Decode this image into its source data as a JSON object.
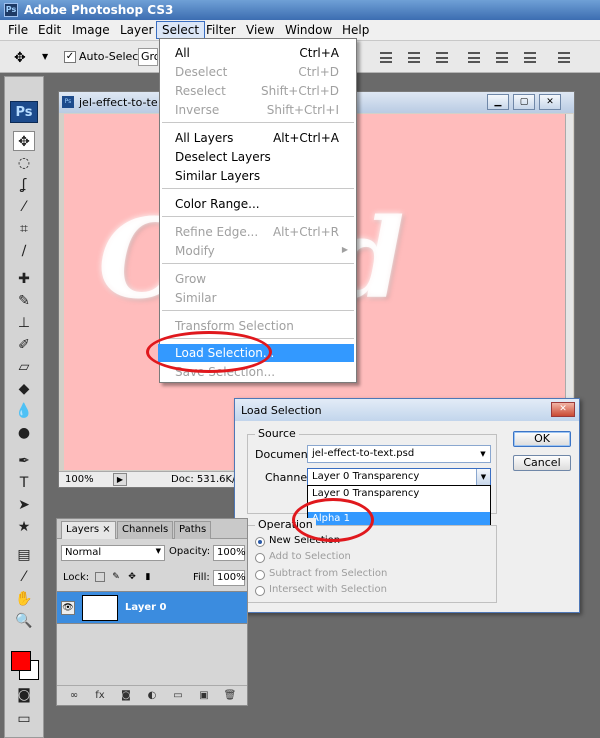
{
  "app": {
    "title": "Adobe Photoshop CS3",
    "logo": "Ps"
  },
  "menubar": {
    "items": [
      "File",
      "Edit",
      "Image",
      "Layer",
      "Select",
      "Filter",
      "View",
      "Window",
      "Help"
    ],
    "active": "Select"
  },
  "options_bar": {
    "auto_select_label": "Auto-Select:",
    "auto_select_checked": true,
    "auto_select_value": "Gro"
  },
  "document": {
    "title": "jel-effect-to-te",
    "zoom": "100%",
    "doc_size": "Doc: 531.6K/1",
    "canvas_color": "#ffbcbc"
  },
  "select_menu": {
    "items": [
      {
        "label": "All",
        "shortcut": "Ctrl+A",
        "disabled": false
      },
      {
        "label": "Deselect",
        "shortcut": "Ctrl+D",
        "disabled": true
      },
      {
        "label": "Reselect",
        "shortcut": "Shift+Ctrl+D",
        "disabled": true
      },
      {
        "label": "Inverse",
        "shortcut": "Shift+Ctrl+I",
        "disabled": true
      },
      {
        "label": "All Layers",
        "shortcut": "Alt+Ctrl+A",
        "disabled": false
      },
      {
        "label": "Deselect Layers",
        "shortcut": "",
        "disabled": false
      },
      {
        "label": "Similar Layers",
        "shortcut": "",
        "disabled": false
      },
      {
        "label": "Color Range...",
        "shortcut": "",
        "disabled": false
      },
      {
        "label": "Refine Edge...",
        "shortcut": "Alt+Ctrl+R",
        "disabled": true
      },
      {
        "label": "Modify",
        "shortcut": "",
        "disabled": true
      },
      {
        "label": "Grow",
        "shortcut": "",
        "disabled": true
      },
      {
        "label": "Similar",
        "shortcut": "",
        "disabled": true
      },
      {
        "label": "Transform Selection",
        "shortcut": "",
        "disabled": true
      },
      {
        "label": "Load Selection...",
        "shortcut": "",
        "disabled": false,
        "highlighted": true
      },
      {
        "label": "Save Selection...",
        "shortcut": "",
        "disabled": true
      }
    ]
  },
  "load_selection_dialog": {
    "title": "Load Selection",
    "source_legend": "Source",
    "document_label": "Document:",
    "document_value": "jel-effect-to-text.psd",
    "channel_label": "Channel:",
    "channel_value": "Layer 0 Transparency",
    "channel_options": [
      "Layer 0 Transparency",
      "Alpha 1"
    ],
    "channel_highlighted": "Alpha 1",
    "operation_legend": "Operation",
    "operations": [
      {
        "label": "New Selection",
        "checked": true,
        "disabled": false
      },
      {
        "label": "Add to Selection",
        "checked": false,
        "disabled": true
      },
      {
        "label": "Subtract from Selection",
        "checked": false,
        "disabled": true
      },
      {
        "label": "Intersect with Selection",
        "checked": false,
        "disabled": true
      }
    ],
    "ok_label": "OK",
    "cancel_label": "Cancel"
  },
  "layers_panel": {
    "tabs": [
      "Layers",
      "Channels",
      "Paths"
    ],
    "active_tab": "Layers",
    "close_glyph": "×",
    "blend_mode": "Normal",
    "opacity_label": "Opacity:",
    "opacity_value": "100%",
    "lock_label": "Lock:",
    "fill_label": "Fill:",
    "fill_value": "100%",
    "layers": [
      {
        "name": "Layer 0",
        "visible": true,
        "selected": true
      }
    ],
    "bottom_icons": [
      "link-icon",
      "fx-icon",
      "mask-icon",
      "adjustment-icon",
      "folder-icon",
      "new-layer-icon",
      "trash-icon"
    ],
    "fx_text": "fx"
  },
  "tools": {
    "foreground_color": "#ff0000",
    "background_color": "#ffffff",
    "list": [
      "move-tool",
      "marquee-tool",
      "lasso-tool",
      "magic-wand-tool",
      "crop-tool",
      "slice-tool",
      "healing-brush-tool",
      "brush-tool",
      "clone-stamp-tool",
      "history-brush-tool",
      "eraser-tool",
      "paint-bucket-tool",
      "blur-tool",
      "dodge-tool",
      "pen-tool",
      "type-tool",
      "path-selection-tool",
      "shape-tool",
      "notes-tool",
      "eyedropper-tool",
      "hand-tool",
      "zoom-tool"
    ]
  }
}
